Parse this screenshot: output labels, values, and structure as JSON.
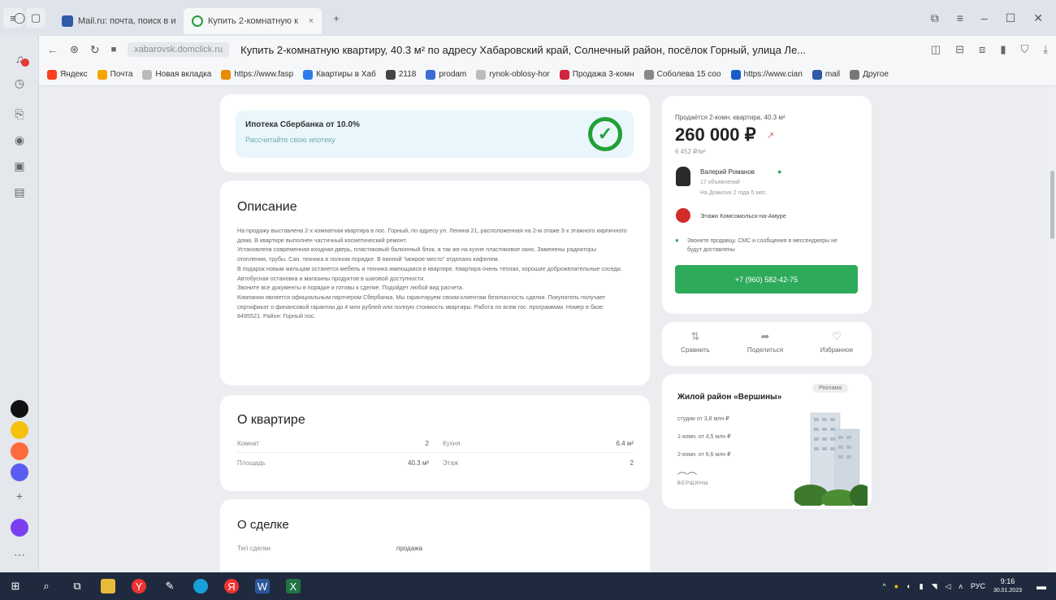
{
  "browser": {
    "tabs": [
      {
        "title": "Mail.ru: почта, поиск в ин",
        "color": "#2f5aa8"
      },
      {
        "title": "Купить 2-комнатную к",
        "color": "#21a038"
      }
    ],
    "address": {
      "domain": "xabarovsk.domclick.ru",
      "title": "Купить 2-комнатную квартиру, 40.3 м² по адресу Хабаровский край, Солнечный район, посёлок Горный, улица Ле..."
    },
    "bookmarks": [
      {
        "label": "Яндекс",
        "color": "#fc3f1d"
      },
      {
        "label": "Почта",
        "color": "#f7a400"
      },
      {
        "label": "Новая вкладка",
        "color": "#bbbbbb"
      },
      {
        "label": "https://www.fasp",
        "color": "#e78b00"
      },
      {
        "label": "Квартиры в Хаб",
        "color": "#2b7de9"
      },
      {
        "label": "2118",
        "color": "#444444"
      },
      {
        "label": "prodam",
        "color": "#3c6bd1"
      },
      {
        "label": "rynok-oblosy-hor",
        "color": "#bbbbbb"
      },
      {
        "label": "Продажа 3-комн",
        "color": "#d0253d"
      },
      {
        "label": "Соболева 15 соо",
        "color": "#888888"
      },
      {
        "label": "https://www.cian",
        "color": "#1b5ac9"
      },
      {
        "label": "mail",
        "color": "#2f5aa8"
      },
      {
        "label": "Другое",
        "color": "#777777"
      }
    ]
  },
  "mortgage": {
    "title": "Ипотека Сбербанка от 10.0%",
    "subtitle": "Рассчитайте свою ипотеку",
    "logo_icon": "sber-check-icon"
  },
  "description": {
    "heading": "Описание",
    "paragraphs": [
      "На продажу выставлена 2-х комнатная квартира в пос. Горный, по адресу ул. Ленина 21, расположенная на 2-м этаже 3-х этажного кирпичного дома. В квартире выполнен частичный косметический ремонт.",
      "Установлена современная входная дверь, пластиковый балконный блок, а так же на кухне пластиковое окно. Заменены радиаторы отопления, трубы. Сан. техника в полном порядке. В ванной \"мокрое место\" отделано кафелем.",
      "В подарок новым жильцам останется мебель и техника имеющаяся в квартире. Квартира очень теплая, хорошие доброжелательные соседи.",
      "Автобусная остановка и магазины продуктов в шаговой доступности.",
      "Звоните все документы в порядке и готовы к сделке. Подойдет любой вид расчета.",
      "Компания является официальным партнером Сбербанка. Мы гарантируем своим клиентам безопасность сделки. Покупатель получает сертификат о финансовой гарантии до 4 млн рублей или полную стоимость квартиры. Работа по всем гос. программам. Номер в базе: 8495521. Район: Горный пос."
    ]
  },
  "apartment": {
    "heading": "О квартире",
    "rows": [
      {
        "label": "Комнат",
        "value": "2"
      },
      {
        "label": "Кухня",
        "value": "6.4 м²"
      },
      {
        "label": "Площадь",
        "value": "40.3 м²"
      },
      {
        "label": "Этаж",
        "value": "2"
      }
    ]
  },
  "deal": {
    "heading": "О сделке",
    "label": "Тип сделки",
    "value": "продажа"
  },
  "offer": {
    "subtitle": "Продаётся 2-комн. квартира, 40.3 м²",
    "price": "260 000 ₽",
    "price_per_m2": "6 452 ₽/м²",
    "agent_name": "Валерий Романов",
    "agent_meta1": "17 объявлений",
    "agent_meta2": "На Домклик 2 года 5 мес.",
    "agency": "Этажи Комсомольск-на-Амуре",
    "notice": "Звоните продавцу. СМС и сообщения в мессенджеры не будут доставлены",
    "phone": "+7 (960) 582-42-75"
  },
  "actions": [
    {
      "label": "Сравнить",
      "icon": "compare-icon"
    },
    {
      "label": "Поделиться",
      "icon": "share-icon"
    },
    {
      "label": "Избранное",
      "icon": "heart-icon"
    }
  ],
  "ad": {
    "title": "Жилой район «Вершины»",
    "badge": "Реклама",
    "lines": [
      "студии от 3,8 млн ₽",
      "1-комн. от 4,5 млн ₽",
      "2-комн. от 6,6 млн ₽"
    ],
    "brand": "ВЕРШИНЫ"
  },
  "taskbar": {
    "lang": "РУС",
    "time": "9:16",
    "date": "30.01.2023"
  }
}
